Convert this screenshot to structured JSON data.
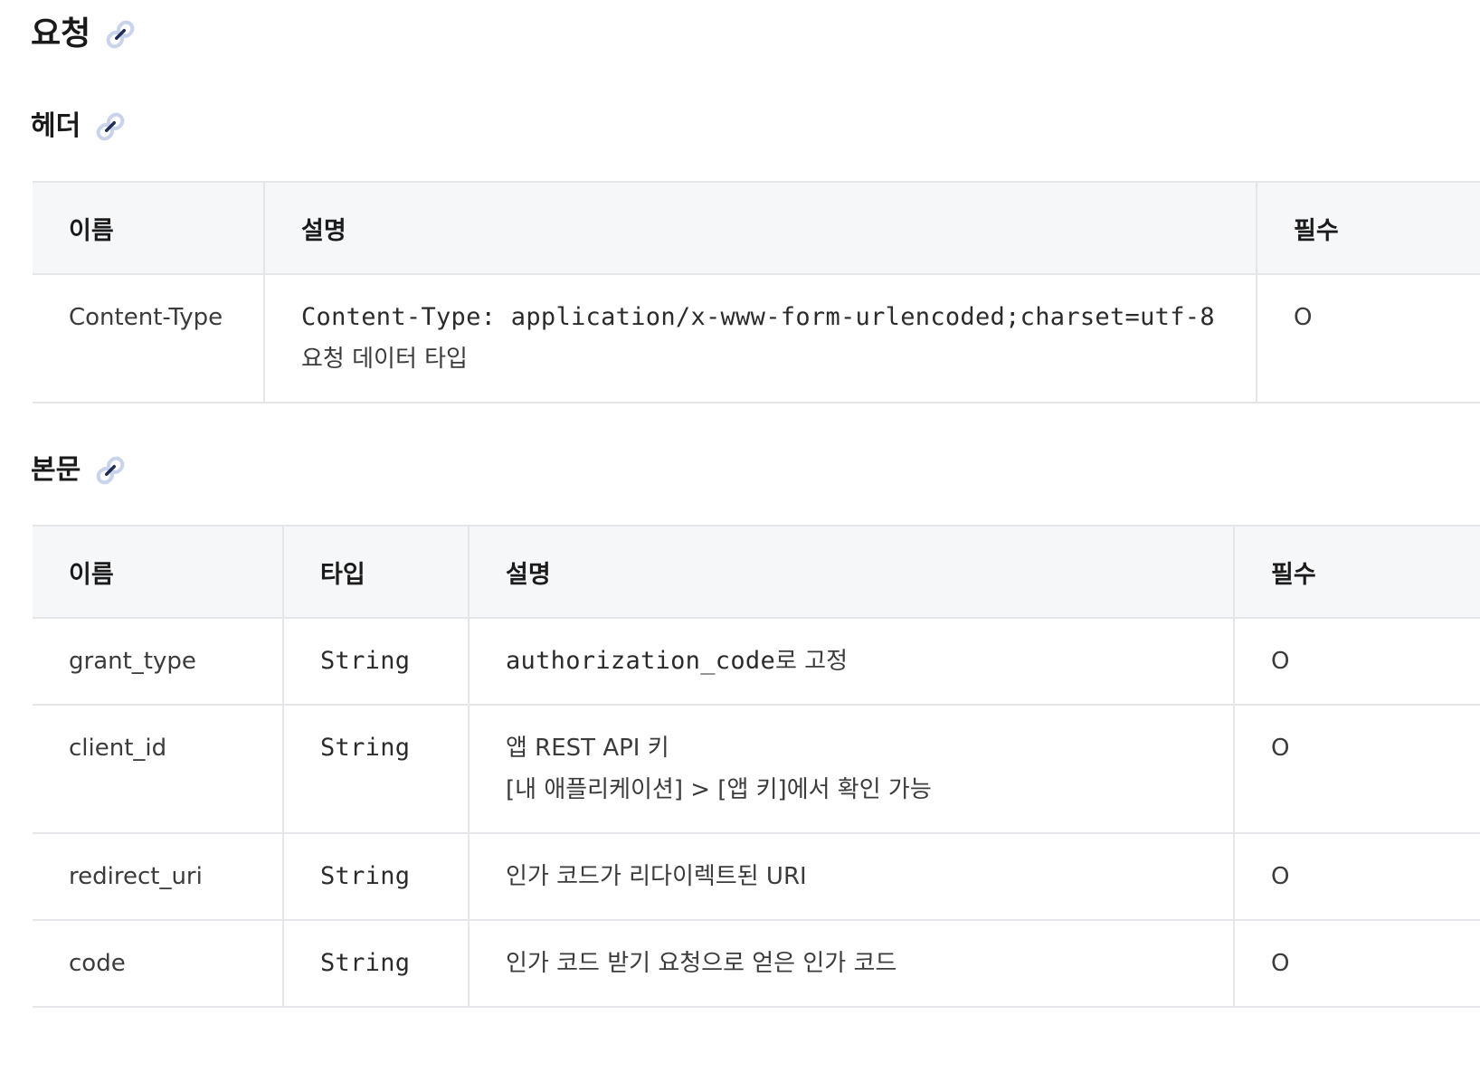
{
  "sections": {
    "request": {
      "title": "요청"
    },
    "header": {
      "title": "헤더"
    },
    "body": {
      "title": "본문"
    }
  },
  "header_table": {
    "columns": [
      "이름",
      "설명",
      "필수"
    ],
    "rows": [
      {
        "name": "Content-Type",
        "desc_code": "Content-Type: application/x-www-form-urlencoded;charset=utf-8",
        "desc_text": "요청 데이터 타입",
        "required": "O"
      }
    ]
  },
  "body_table": {
    "columns": [
      "이름",
      "타입",
      "설명",
      "필수"
    ],
    "rows": [
      {
        "name": "grant_type",
        "type": "String",
        "desc_code": "authorization_code",
        "desc_suffix": "로 고정",
        "required": "O"
      },
      {
        "name": "client_id",
        "type": "String",
        "desc_line1": "앱 REST API 키",
        "desc_line2": "[내 애플리케이션] > [앱 키]에서 확인 가능",
        "required": "O"
      },
      {
        "name": "redirect_uri",
        "type": "String",
        "desc_line1": "인가 코드가 리다이렉트된 URI",
        "required": "O"
      },
      {
        "name": "code",
        "type": "String",
        "desc_line1": "인가 코드 받기 요청으로 얻은 인가 코드",
        "required": "O"
      }
    ]
  },
  "icons": {
    "anchor": "link-icon"
  },
  "colors": {
    "header_bg": "#f6f7f9",
    "border": "#e4e6ea",
    "link_icon": "#c9d4ec"
  }
}
